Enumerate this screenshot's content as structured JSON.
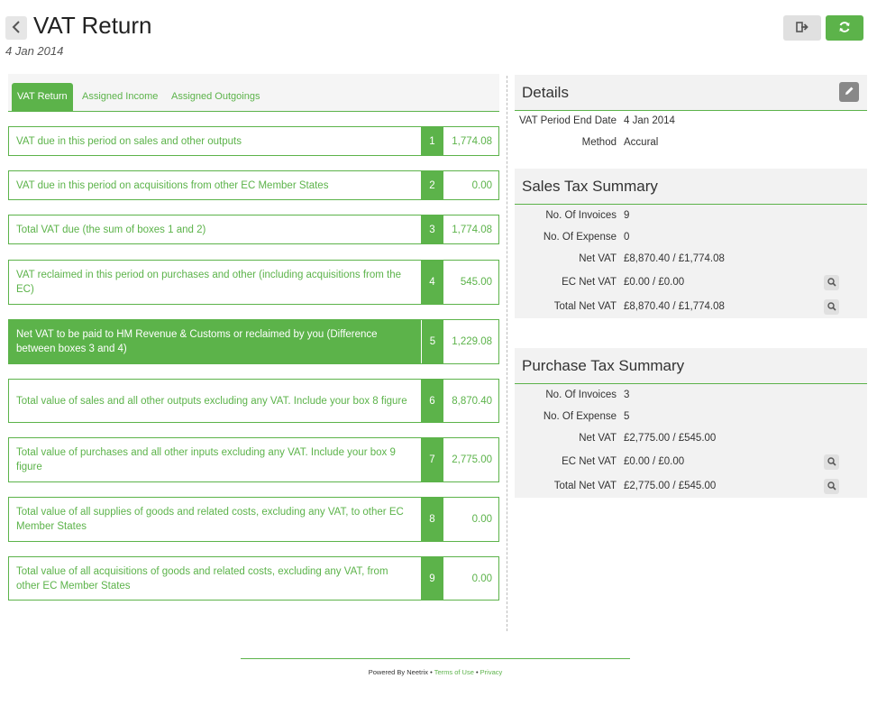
{
  "header": {
    "title": "VAT Return",
    "date": "4 Jan 2014",
    "back_icon": "chevron-left-icon",
    "exit_icon": "sign-out-icon",
    "refresh_icon": "refresh-icon"
  },
  "tabs": [
    {
      "label": "VAT Return",
      "active": true
    },
    {
      "label": "Assigned Income",
      "active": false
    },
    {
      "label": "Assigned Outgoings",
      "active": false
    }
  ],
  "boxes": [
    {
      "label": "VAT due in this period on sales and other outputs",
      "num": "1",
      "value": "1,774.08"
    },
    {
      "label": "VAT due in this period on acquisitions from other EC Member States",
      "num": "2",
      "value": "0.00"
    },
    {
      "label": "Total VAT due (the sum of boxes 1 and 2)",
      "num": "3",
      "value": "1,774.08"
    },
    {
      "label": "VAT reclaimed in this period on purchases and other (including acquisitions from the EC)",
      "num": "4",
      "value": "545.00"
    },
    {
      "label": "Net VAT to be paid to HM Revenue & Customs or reclaimed by you (Difference between boxes 3 and 4)",
      "num": "5",
      "value": "1,229.08"
    },
    {
      "label": "Total value of sales and all other outputs excluding any VAT. Include your box 8 figure",
      "num": "6",
      "value": "8,870.40"
    },
    {
      "label": "Total value of purchases and all other inputs excluding any VAT. Include your box 9 figure",
      "num": "7",
      "value": "2,775.00"
    },
    {
      "label": "Total value of all supplies of goods and related costs, excluding any VAT, to other EC Member States",
      "num": "8",
      "value": "0.00"
    },
    {
      "label": "Total value of all acquisitions of goods and related costs, excluding any VAT, from other EC Member States",
      "num": "9",
      "value": "0.00"
    }
  ],
  "details": {
    "title": "Details",
    "edit_icon": "pencil-icon",
    "rows": [
      {
        "key": "VAT Period End Date",
        "value": "4 Jan 2014"
      },
      {
        "key": "Method",
        "value": "Accural"
      }
    ]
  },
  "sales_summary": {
    "title": "Sales Tax Summary",
    "rows": [
      {
        "key": "No. Of Invoices",
        "value": "9"
      },
      {
        "key": "No. Of Expense",
        "value": "0"
      },
      {
        "key": "Net VAT",
        "value": "£8,870.40 / £1,774.08"
      },
      {
        "key": "EC Net VAT",
        "value": "£0.00 / £0.00"
      },
      {
        "key": "Total Net VAT",
        "value": "£8,870.40 / £1,774.08"
      }
    ]
  },
  "purchase_summary": {
    "title": "Purchase Tax Summary",
    "rows": [
      {
        "key": "No. Of Invoices",
        "value": "3"
      },
      {
        "key": "No. Of Expense",
        "value": "5"
      },
      {
        "key": "Net VAT",
        "value": "£2,775.00 / £545.00"
      },
      {
        "key": "EC Net VAT",
        "value": "£0.00 / £0.00"
      },
      {
        "key": "Total Net VAT",
        "value": "£2,775.00 / £545.00"
      }
    ]
  },
  "footer": {
    "powered": "Powered By Neetrix",
    "sep1": " • ",
    "terms": "Terms of Use",
    "sep2": " • ",
    "privacy": "Privacy"
  },
  "colors": {
    "accent": "#5cb34a"
  }
}
